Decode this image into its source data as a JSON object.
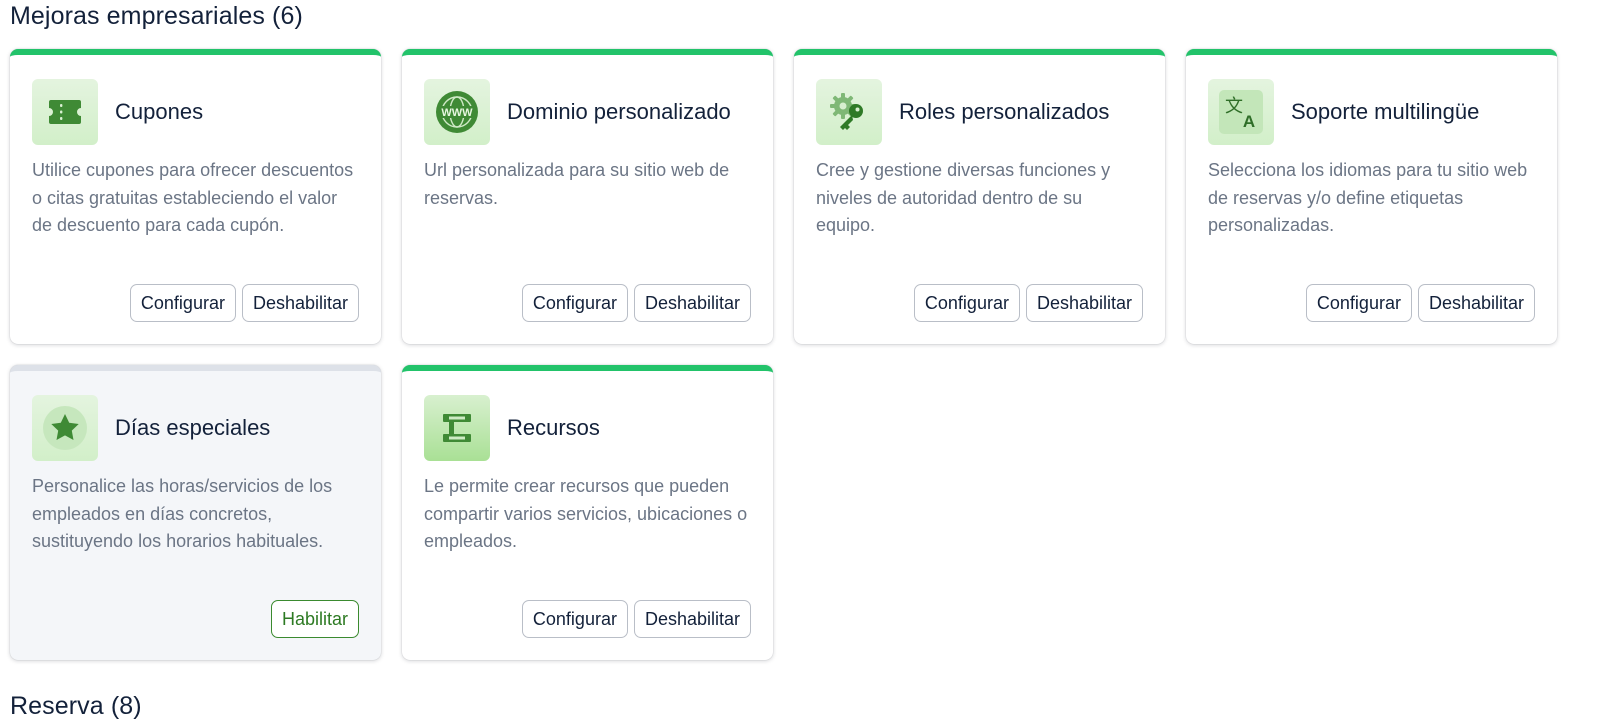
{
  "sections": [
    {
      "title": "Mejoras empresariales (6)"
    },
    {
      "title": "Reserva (8)"
    }
  ],
  "colors": {
    "accent_green": "#22c36a",
    "disabled_bar": "#dde1e8",
    "icon_green": "#3f8a35",
    "enable_text": "#2d7a23"
  },
  "cards": [
    {
      "title": "Cupones",
      "icon": "ticket-icon",
      "description": "Utilice cupones para ofrecer descuentos o citas gratuitas estableciendo el valor de descuento para cada cupón.",
      "enabled": true,
      "configure_label": "Configurar",
      "disable_label": "Deshabilitar"
    },
    {
      "title": "Dominio personalizado",
      "icon": "globe-www-icon",
      "description": "Url personalizada para su sitio web de reservas.",
      "enabled": true,
      "configure_label": "Configurar",
      "disable_label": "Deshabilitar"
    },
    {
      "title": "Roles personalizados",
      "icon": "gear-key-icon",
      "description": "Cree y gestione diversas funciones y niveles de autoridad dentro de su equipo.",
      "enabled": true,
      "configure_label": "Configurar",
      "disable_label": "Deshabilitar"
    },
    {
      "title": "Soporte multilingüe",
      "icon": "translate-icon",
      "description": "Selecciona los idiomas para tu sitio web de reservas y/o define etiquetas personalizadas.",
      "enabled": true,
      "configure_label": "Configurar",
      "disable_label": "Deshabilitar"
    },
    {
      "title": "Días especiales",
      "icon": "star-icon",
      "description": "Personalice las horas/servicios de los empleados en días concretos, sustituyendo los horarios habituales.",
      "enabled": false,
      "enable_label": "Habilitar"
    },
    {
      "title": "Recursos",
      "icon": "resources-icon",
      "description": "Le permite crear recursos que pueden compartir varios servicios, ubicaciones o empleados.",
      "enabled": true,
      "configure_label": "Configurar",
      "disable_label": "Deshabilitar"
    }
  ]
}
